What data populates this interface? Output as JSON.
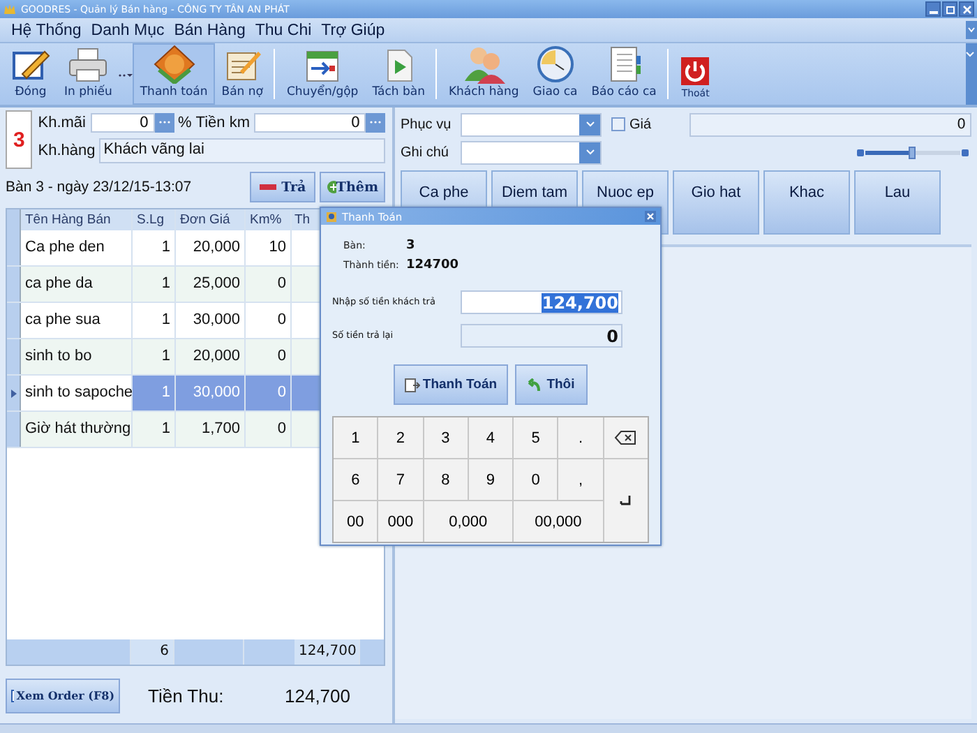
{
  "window": {
    "title": "GOODRES - Quản lý Bán hàng - CÔNG TY TÂN AN PHÁT"
  },
  "menu": [
    "Hệ Thống",
    "Danh Mục",
    "Bán Hàng",
    "Thu Chi",
    "Trợ Giúp"
  ],
  "toolbar": [
    {
      "label": "Đóng",
      "selected": false
    },
    {
      "label": "In phiếu",
      "selected": false
    },
    {
      "label": "Thanh toán",
      "selected": true
    },
    {
      "label": "Bán nợ",
      "selected": false
    },
    {
      "label": "Chuyển/gộp",
      "selected": false
    },
    {
      "label": "Tách bàn",
      "selected": false
    },
    {
      "label": "Khách hàng",
      "selected": false
    },
    {
      "label": "Giao ca",
      "selected": false
    },
    {
      "label": "Báo cáo ca",
      "selected": false
    },
    {
      "label": "Thoát",
      "selected": false
    }
  ],
  "order": {
    "table_number": "3",
    "discount": {
      "label": "Kh.mãi",
      "value": "0",
      "unit": "%"
    },
    "discount_amount": {
      "label": "Tiền km",
      "value": "0"
    },
    "customer": {
      "label": "Kh.hàng",
      "value": "Khách vãng lai"
    },
    "title": "Bàn 3 - ngày 23/12/15-13:07",
    "buttons": [
      {
        "label": "Trả",
        "kind": "minus"
      },
      {
        "label": "Thêm",
        "kind": "plus"
      }
    ],
    "table": {
      "columns": [
        "Tên Hàng Bán",
        "S.Lg",
        "Đơn Giá",
        "Km%",
        "Th"
      ],
      "rows": [
        {
          "cells": [
            "Ca phe den",
            "1",
            "20,000",
            "10"
          ],
          "selected": false
        },
        {
          "cells": [
            "ca phe da",
            "1",
            "25,000",
            "0"
          ],
          "selected": false
        },
        {
          "cells": [
            "ca phe sua",
            "1",
            "30,000",
            "0"
          ],
          "selected": false
        },
        {
          "cells": [
            "sinh to bo",
            "1",
            "20,000",
            "0"
          ],
          "selected": false
        },
        {
          "cells": [
            "sinh to sapoche",
            "1",
            "30,000",
            "0"
          ],
          "selected": true
        },
        {
          "cells": [
            "Giờ hát thường",
            "1",
            "1,700",
            "0"
          ],
          "selected": false
        }
      ],
      "footer": {
        "quantity": "6",
        "total": "124,700"
      }
    },
    "view_order_button": "Xem Order (F8)",
    "total": {
      "label": "Tiền Thu:",
      "value": "124,700"
    }
  },
  "menu_panel": {
    "server_label": "Phục vụ",
    "note_label": "Ghi chú",
    "price": {
      "label": "Giá",
      "checked": false,
      "value": "0"
    },
    "zoom_slider": {
      "level": 0.5
    },
    "categories": [
      "Ca phe",
      "Diem tam",
      "Nuoc ep",
      "Gio hat",
      "Khac",
      "Lau"
    ]
  },
  "dialog": {
    "title": "Thanh Toán",
    "table_label": "Bàn:",
    "table_value": "3",
    "amount_label": "Thành tiền:",
    "amount_value": "124700",
    "paid": {
      "label": "Nhập số tiền khách trả",
      "value": "124,700"
    },
    "change": {
      "label": "Số tiền trả lại",
      "value": "0"
    },
    "buttons": [
      {
        "label": "Thanh Toán",
        "kind": "pay"
      },
      {
        "label": "Thôi",
        "kind": "cancel"
      }
    ],
    "keys": [
      {
        "kind": "text",
        "label": "1"
      },
      {
        "kind": "text",
        "label": "2"
      },
      {
        "kind": "text",
        "label": "3"
      },
      {
        "kind": "text",
        "label": "4"
      },
      {
        "kind": "text",
        "label": "5"
      },
      {
        "kind": "text",
        "label": "."
      },
      {
        "kind": "backspace"
      },
      {
        "kind": "text",
        "label": "6"
      },
      {
        "kind": "text",
        "label": "7"
      },
      {
        "kind": "text",
        "label": "8"
      },
      {
        "kind": "text",
        "label": "9"
      },
      {
        "kind": "text",
        "label": "0"
      },
      {
        "kind": "text",
        "label": ","
      },
      {
        "kind": "enter"
      },
      {
        "kind": "text",
        "label": "00"
      },
      {
        "kind": "text",
        "label": "000"
      },
      {
        "kind": "wide",
        "label": "0,000"
      },
      {
        "kind": "wide",
        "label": "00,000"
      }
    ]
  }
}
